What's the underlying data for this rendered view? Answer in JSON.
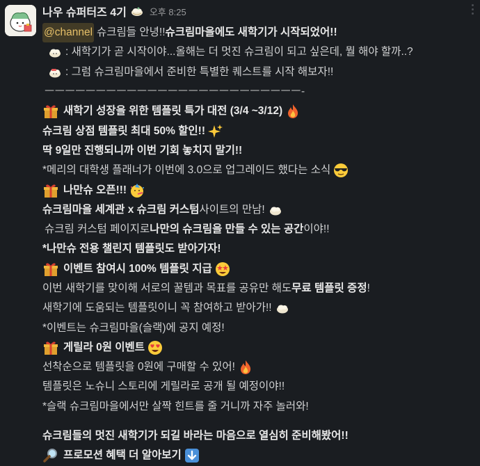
{
  "message": {
    "sender": "나우 슈퍼터즈 4기",
    "time": "오후 8:25",
    "lines": {
      "l1a": "@channel",
      "l1b": "슈크림들 안녕!! ",
      "l1c": "슈크림마을에도 새학기가 시작되었어!!",
      "l2": ": 새학기가 곧 시작이야...올해는 더 멋진 슈크림이 되고 싶은데, 뭘 해야 할까..?",
      "l3": ": 그럼 슈크림마을에서 준비한 특별한 퀘스트를 시작 해보자!!",
      "l4": "ㅡㅡㅡㅡㅡㅡㅡㅡㅡㅡㅡㅡㅡㅡㅡㅡㅡㅡㅡㅡㅡㅡㅡㅡㅡ-",
      "l5": "새학기 성장을 위한 템플릿 특가 대전 (3/4 ~3/12)",
      "l6": "슈크림 상점 템플릿 최대 50% 할인!!",
      "l7": "딱 9일만 진행되니까 이번 기회 놓치지 말기!!",
      "l8": "*메리의 대학생 플래너가 이번에 3.0으로 업그레이드 했다는 소식",
      "l9": "나만슈 오픈!!!",
      "l10a": "슈크림마을 세계관 x 슈크림 커스텀",
      "l10b": " 사이트의 만남!",
      "l11a": "슈크림 커스텀 페이지로 ",
      "l11b": "나만의 슈크림을 만들 수 있는 공간",
      "l11c": "이야!!",
      "l12": "*나만슈 전용 챌린지 템플릿도 받아가자!",
      "l13": "이벤트 참여시 100% 템플릿 지급",
      "l14a": "이번 새학기를 맞이해 서로의 꿀템과 목표를 공유만 해도 ",
      "l14b": "무료 템플릿 증정",
      "l14c": "!",
      "l15": "새학기에 도움되는 템플릿이니 꼭 참여하고 받아가!!",
      "l16": "*이벤트는 슈크림마을(슬랙)에 공지 예정!",
      "l17": "게릴라 0원 이벤트",
      "l18": "선착순으로 템플릿을 0원에 구매할 수 있어!",
      "l19": "템플릿은 노슈니 스토리에 게릴라로 공개 될 예정이야!!",
      "l20": "*슬랙 슈크림마을에서만 살짝 힌트를 줄 거니까 자주 놀러와!",
      "l21": "슈크림들의 멋진 새학기가 되길 바라는 마음으로 열심히 준비해봤어!!",
      "l22": "프로모션 혜택 더 알아보기"
    }
  },
  "colors": {
    "background": "#1a1d21",
    "text": "#d1d2d3",
    "mention_bg": "#4a3f22",
    "mention_text": "#e6c069"
  },
  "icons": [
    "chick-avatar",
    "gift-icon",
    "fire-icon",
    "sparkles-icon",
    "sunglasses-icon",
    "party-face-icon",
    "star-eyes-icon",
    "heart-eyes-icon",
    "cream-puff-icon",
    "magnifier-icon",
    "down-arrow-icon",
    "more-actions-icon"
  ]
}
